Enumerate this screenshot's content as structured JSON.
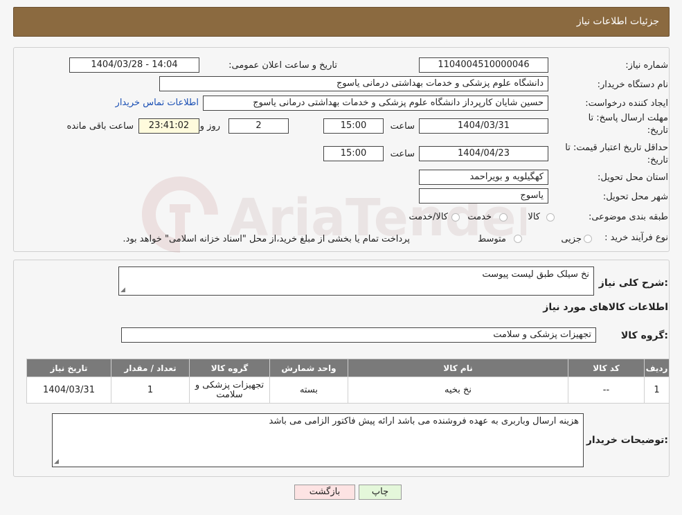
{
  "header": {
    "title": "جزئیات اطلاعات نیاز"
  },
  "form": {
    "need_number_label": "شماره نیاز:",
    "need_number": "1104004510000046",
    "announce_label": "تاریخ و ساعت اعلان عمومی:",
    "announce_value": "1404/03/28 - 14:04",
    "buyer_label": "نام دستگاه خریدار:",
    "buyer_value": "دانشگاه علوم پزشکی و خدمات بهداشتی  درمانی یاسوج",
    "creator_label": "ایجاد کننده درخواست:",
    "creator_value": "حسین شایان کارپرداز دانشگاه علوم پزشکی و خدمات بهداشتی  درمانی یاسوج",
    "contact_link": "اطلاعات تماس خریدار",
    "deadline_label_1": "مهلت ارسال پاسخ: تا",
    "deadline_label_2": "تاریخ:",
    "deadline_date": "1404/03/31",
    "time_label": "ساعت",
    "deadline_time": "15:00",
    "days_value": "2",
    "days_label": "روز و",
    "remaining_time": "23:41:02",
    "remaining_label": "ساعت باقی مانده",
    "validity_label_1": "حداقل تاریخ اعتبار قیمت: تا",
    "validity_label_2": "تاریخ:",
    "validity_date": "1404/04/23",
    "validity_time": "15:00",
    "province_label": "استان محل تحویل:",
    "province_value": "کهگیلویه و بویراحمد",
    "city_label": "شهر محل تحویل:",
    "city_value": "یاسوج",
    "category_label": "طبقه بندی موضوعی:",
    "category_options": [
      "کالا",
      "خدمت",
      "کالا/خدمت"
    ],
    "process_label": "نوع فرآیند خرید :",
    "process_options": [
      "جزیی",
      "متوسط"
    ],
    "process_note": "پرداخت تمام یا بخشی از مبلغ خرید،از محل \"اسناد خزانه اسلامی\" خواهد بود."
  },
  "details": {
    "description_label": "شرح کلی نیاز:",
    "description_value": "نخ سیلک طبق لیست پیوست",
    "goods_info_title": "اطلاعات کالاهای مورد نیاز",
    "goods_group_label": "گروه کالا:",
    "goods_group_value": "تجهیزات پزشکی و سلامت",
    "table": {
      "headers": [
        "ردیف",
        "کد کالا",
        "نام کالا",
        "واحد شمارش",
        "گروه کالا",
        "تعداد / مقدار",
        "تاریخ نیاز"
      ],
      "rows": [
        [
          "1",
          "--",
          "نخ بخیه",
          "بسته",
          "تجهیزات پزشکی و سلامت",
          "1",
          "1404/03/31"
        ]
      ]
    },
    "buyer_notes_label": "توضیحات خریدار:",
    "buyer_notes_value": "هزینه ارسال وباربری به عهده فروشنده می باشد ارائه پیش فاکتور الزامی می باشد"
  },
  "buttons": {
    "print": "چاپ",
    "back": "بازگشت"
  },
  "watermark_text": "AriaTender.neT",
  "colors": {
    "header": "#8b6a40",
    "link": "#1a4fb4",
    "print_button": "#e4f7da",
    "back_button": "#fde3e3"
  }
}
